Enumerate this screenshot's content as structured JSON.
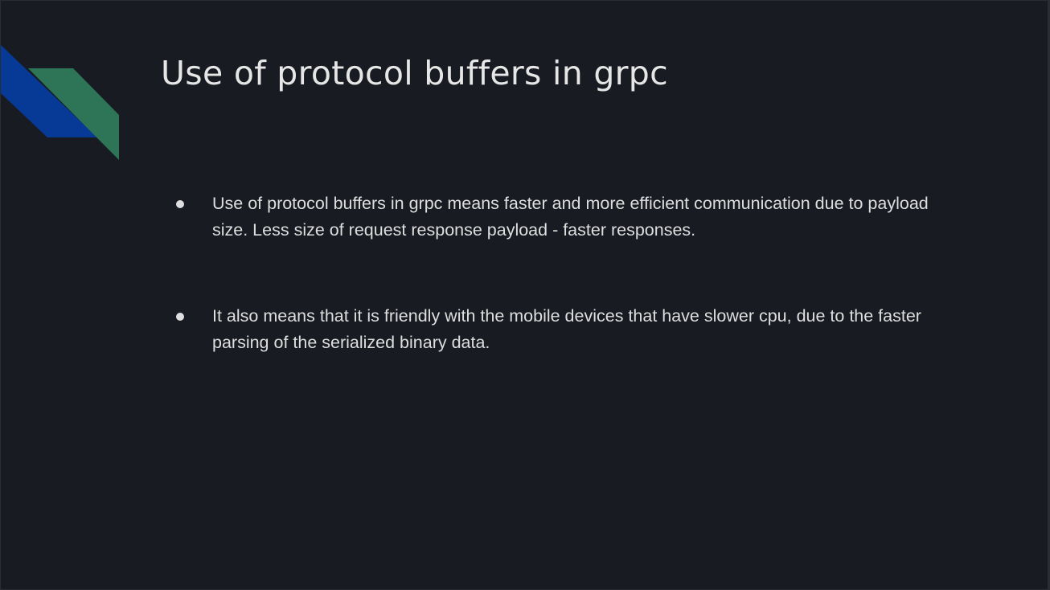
{
  "slide": {
    "title": "Use of protocol buffers in grpc",
    "bullets": [
      "Use of protocol buffers in grpc means faster and more efficient communication due to payload size. Less size of request response payload - faster responses.",
      "It also means that it is friendly with the mobile devices that have slower cpu, due to the faster parsing of the serialized binary data."
    ]
  },
  "theme": {
    "background": "#181b22",
    "text_color": "#e6e6e6",
    "accent_blue": "#063a96",
    "accent_green": "#2e7558"
  }
}
